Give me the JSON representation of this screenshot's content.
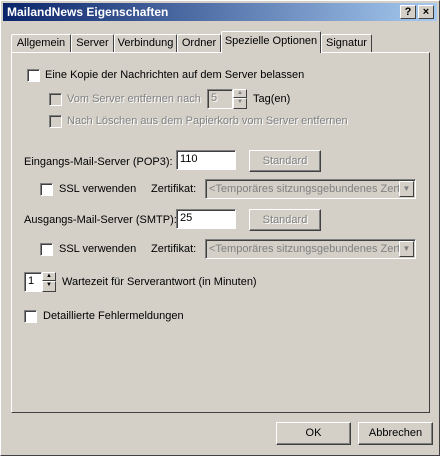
{
  "window": {
    "title": "MailandNews Eigenschaften",
    "help_label": "?",
    "close_label": "×"
  },
  "tabs": [
    {
      "label": "Allgemein"
    },
    {
      "label": "Server"
    },
    {
      "label": "Verbindung"
    },
    {
      "label": "Ordner"
    },
    {
      "label": "Spezielle Optionen"
    },
    {
      "label": "Signatur"
    }
  ],
  "active_tab": "Spezielle Optionen",
  "options": {
    "keep_copy": {
      "label": "Eine Kopie der Nachrichten auf dem Server belassen",
      "checked": false
    },
    "remove_after": {
      "label": "Vom Server entfernen nach",
      "value": "5",
      "unit": "Tag(en)",
      "checked": false
    },
    "remove_on_trash": {
      "label": "Nach Löschen aus dem Papierkorb vom Server entfernen",
      "checked": false
    },
    "incoming": {
      "label": "Eingangs-Mail-Server (POP3):",
      "value": "110",
      "default_button": "Standard",
      "ssl_label": "SSL verwenden",
      "cert_label": "Zertifikat:",
      "cert_value": "<Temporäres sitzungsgebundenes Zertif"
    },
    "outgoing": {
      "label": "Ausgangs-Mail-Server (SMTP):",
      "value": "25",
      "default_button": "Standard",
      "ssl_label": "SSL verwenden",
      "cert_label": "Zertifikat:",
      "cert_value": "<Temporäres sitzungsgebundenes Zertif"
    },
    "timeout": {
      "value": "1",
      "label": "Wartezeit für Serverantwort (in Minuten)"
    },
    "detailed_errors": {
      "label": "Detaillierte Fehlermeldungen",
      "checked": false
    }
  },
  "footer": {
    "ok_label": "OK",
    "cancel_label": "Abbrechen"
  }
}
